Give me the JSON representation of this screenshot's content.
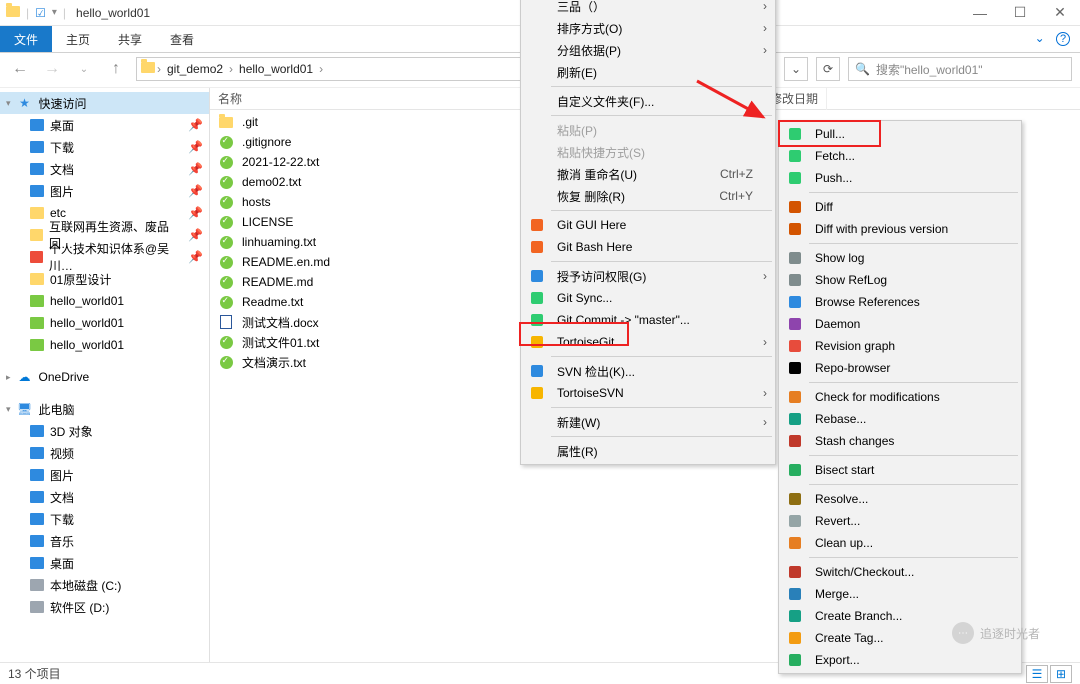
{
  "title": "hello_world01",
  "ribbon": {
    "file": "文件",
    "tabs": [
      "主页",
      "共享",
      "查看"
    ]
  },
  "breadcrumbs": [
    "git_demo2",
    "hello_world01"
  ],
  "refresh_dd": "⌄",
  "search_placeholder": "搜索\"hello_world01\"",
  "columns": {
    "name": "名称",
    "date": "修改日期"
  },
  "sidebar_quick": "快速访问",
  "sidebar_items": [
    {
      "label": "桌面",
      "pin": true,
      "c": "#2e8adf"
    },
    {
      "label": "下载",
      "pin": true,
      "c": "#2e8adf"
    },
    {
      "label": "文档",
      "pin": true,
      "c": "#2e8adf"
    },
    {
      "label": "图片",
      "pin": true,
      "c": "#2e8adf"
    },
    {
      "label": "etc",
      "pin": true,
      "c": "#ffd76b"
    },
    {
      "label": "互联网再生资源、废品回…",
      "pin": true,
      "c": "#ffd76b"
    },
    {
      "label": "个人技术知识体系@吴川…",
      "pin": true,
      "c": "#ed4c3a"
    },
    {
      "label": "01原型设计",
      "pin": false,
      "c": "#ffd76b"
    },
    {
      "label": "hello_world01",
      "pin": false,
      "c": "#7ac943"
    },
    {
      "label": "hello_world01",
      "pin": false,
      "c": "#7ac943"
    },
    {
      "label": "hello_world01",
      "pin": false,
      "c": "#7ac943"
    }
  ],
  "onedrive": "OneDrive",
  "thispc": "此电脑",
  "pc_items": [
    {
      "label": "3D 对象",
      "c": "#2e8adf"
    },
    {
      "label": "视频",
      "c": "#2e8adf"
    },
    {
      "label": "图片",
      "c": "#2e8adf"
    },
    {
      "label": "文档",
      "c": "#2e8adf"
    },
    {
      "label": "下载",
      "c": "#2e8adf"
    },
    {
      "label": "音乐",
      "c": "#2e8adf"
    },
    {
      "label": "桌面",
      "c": "#2e8adf"
    },
    {
      "label": "本地磁盘 (C:)",
      "c": "#9da6b0"
    },
    {
      "label": "软件区 (D:)",
      "c": "#9da6b0"
    }
  ],
  "files": [
    {
      "name": ".git",
      "type": "folder"
    },
    {
      "name": ".gitignore",
      "type": "git"
    },
    {
      "name": "2021-12-22.txt",
      "type": "git"
    },
    {
      "name": "demo02.txt",
      "type": "git"
    },
    {
      "name": "hosts",
      "type": "git"
    },
    {
      "name": "LICENSE",
      "type": "git"
    },
    {
      "name": "linhuaming.txt",
      "type": "git"
    },
    {
      "name": "README.en.md",
      "type": "git"
    },
    {
      "name": "README.md",
      "type": "git"
    },
    {
      "name": "Readme.txt",
      "type": "git"
    },
    {
      "name": "测试文档.docx",
      "type": "docx"
    },
    {
      "name": "测试文件01.txt",
      "type": "git"
    },
    {
      "name": "文档演示.txt",
      "type": "git"
    }
  ],
  "status": "13 个项目",
  "menu1": [
    {
      "label": "三品（）",
      "arrow": true,
      "partial": true
    },
    {
      "label": "排序方式(O)",
      "arrow": true
    },
    {
      "label": "分组依据(P)",
      "arrow": true
    },
    {
      "label": "刷新(E)"
    },
    {
      "sep": true
    },
    {
      "label": "自定义文件夹(F)..."
    },
    {
      "sep": true
    },
    {
      "label": "粘贴(P)",
      "disabled": true
    },
    {
      "label": "粘贴快捷方式(S)",
      "disabled": true
    },
    {
      "label": "撤消 重命名(U)",
      "shortcut": "Ctrl+Z"
    },
    {
      "label": "恢复 删除(R)",
      "shortcut": "Ctrl+Y"
    },
    {
      "sep": true
    },
    {
      "label": "Git GUI Here",
      "ic": "#f26522"
    },
    {
      "label": "Git Bash Here",
      "ic": "#f26522"
    },
    {
      "sep": true
    },
    {
      "label": "授予访问权限(G)",
      "arrow": true,
      "ic": "#2e8adf"
    },
    {
      "label": "Git Sync...",
      "ic": "#2ecc71"
    },
    {
      "label": "Git Commit -> \"master\"...",
      "ic": "#2ecc71"
    },
    {
      "label": "TortoiseGit",
      "arrow": true,
      "ic": "#f7b500",
      "hl": true
    },
    {
      "sep": true
    },
    {
      "label": "SVN 检出(K)...",
      "ic": "#2e8adf"
    },
    {
      "label": "TortoiseSVN",
      "arrow": true,
      "ic": "#f7b500"
    },
    {
      "sep": true
    },
    {
      "label": "新建(W)",
      "arrow": true
    },
    {
      "sep": true
    },
    {
      "label": "属性(R)"
    }
  ],
  "menu2": [
    {
      "label": "Pull...",
      "ic": "#2ecc71",
      "hl": true
    },
    {
      "label": "Fetch...",
      "ic": "#2ecc71"
    },
    {
      "label": "Push...",
      "ic": "#2ecc71"
    },
    {
      "sep": true
    },
    {
      "label": "Diff",
      "ic": "#d35400"
    },
    {
      "label": "Diff with previous version",
      "ic": "#d35400"
    },
    {
      "sep": true
    },
    {
      "label": "Show log",
      "ic": "#7f8c8d"
    },
    {
      "label": "Show RefLog",
      "ic": "#7f8c8d"
    },
    {
      "label": "Browse References",
      "ic": "#2e8adf"
    },
    {
      "label": "Daemon",
      "ic": "#8e44ad"
    },
    {
      "label": "Revision graph",
      "ic": "#e74c3c"
    },
    {
      "label": "Repo-browser",
      "ic": "#000"
    },
    {
      "sep": true
    },
    {
      "label": "Check for modifications",
      "ic": "#e67e22"
    },
    {
      "label": "Rebase...",
      "ic": "#16a085"
    },
    {
      "label": "Stash changes",
      "ic": "#c0392b"
    },
    {
      "sep": true
    },
    {
      "label": "Bisect start",
      "ic": "#27ae60"
    },
    {
      "sep": true
    },
    {
      "label": "Resolve...",
      "ic": "#8e6e12"
    },
    {
      "label": "Revert...",
      "ic": "#95a5a6"
    },
    {
      "label": "Clean up...",
      "ic": "#e67e22"
    },
    {
      "sep": true
    },
    {
      "label": "Switch/Checkout...",
      "ic": "#c0392b"
    },
    {
      "label": "Merge...",
      "ic": "#2980b9"
    },
    {
      "label": "Create Branch...",
      "ic": "#16a085"
    },
    {
      "label": "Create Tag...",
      "ic": "#f39c12"
    },
    {
      "label": "Export...",
      "ic": "#27ae60"
    }
  ],
  "watermark": "追逐时光者"
}
